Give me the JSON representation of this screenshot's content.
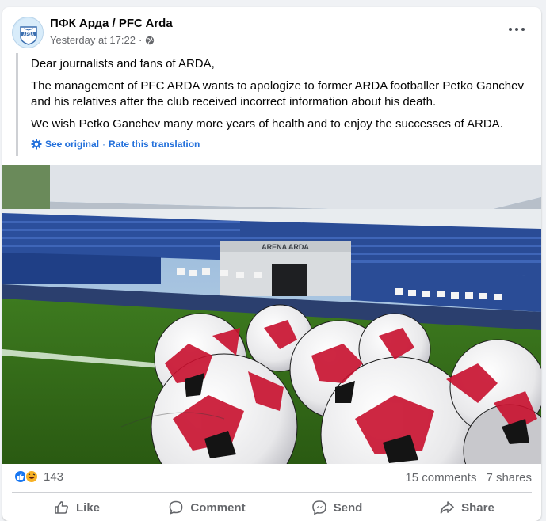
{
  "post": {
    "page_name": "ПФК Арда / PFC Arda",
    "timestamp": "Yesterday at 17:22",
    "separator": "·",
    "audience_icon": "globe-icon",
    "avatar_text": "АРДА",
    "more_icon": "more-dots-icon"
  },
  "translation": {
    "paragraphs": [
      "Dear journalists and fans of ARDA,",
      "The management of PFC ARDA wants to apologize to former ARDA footballer Petko Ganchev and his relatives after the club received incorrect information about his death.",
      "We wish Petko Ganchev many more years of health and to enjoy the successes of ARDA."
    ],
    "see_original": "See original",
    "dot": "·",
    "rate": "Rate this translation"
  },
  "photo": {
    "stadium_sign": "ARENA ARDA"
  },
  "engagement": {
    "reaction_count": "143",
    "comments": "15 comments",
    "shares": "7 shares",
    "reaction_icons": [
      "like-reaction-icon",
      "haha-reaction-icon"
    ]
  },
  "actions": {
    "like": "Like",
    "comment": "Comment",
    "send": "Send",
    "share": "Share"
  },
  "colors": {
    "link_blue": "#216fdb",
    "muted_text": "#65676b",
    "like_blue": "#1877f2",
    "haha_yellow": "#f7b125"
  }
}
